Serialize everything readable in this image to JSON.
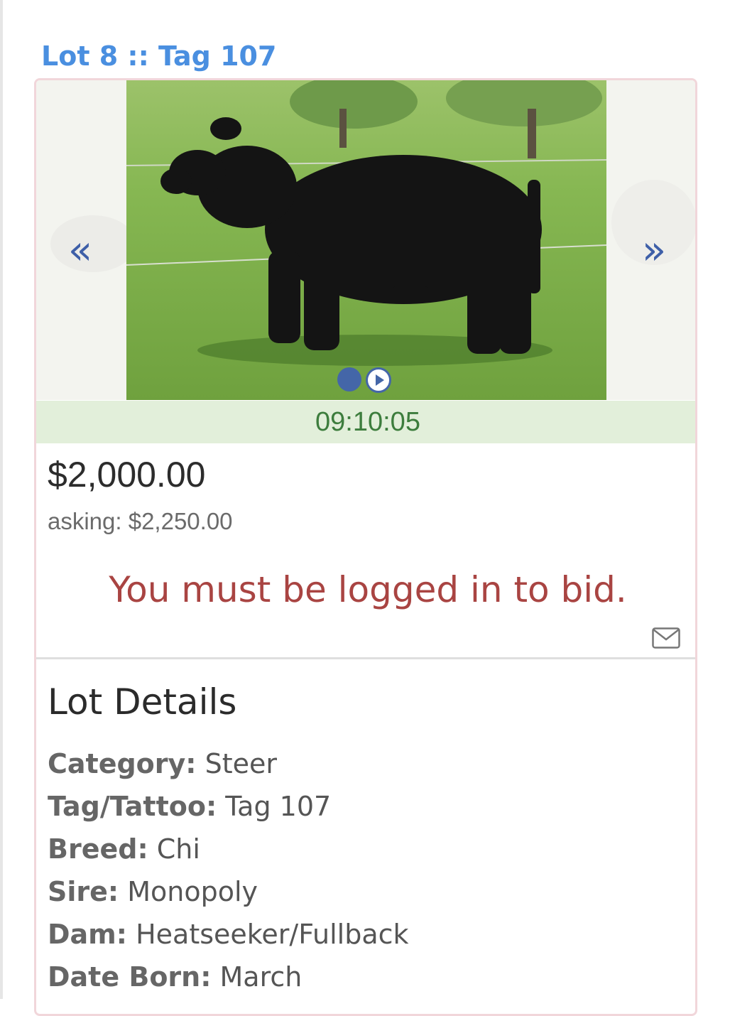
{
  "lot": {
    "heading": "Lot 8 :: Tag 107"
  },
  "gallery": {
    "prev_icon": "double-chevron-left-icon",
    "next_icon": "double-chevron-right-icon",
    "prev_glyph": "«",
    "next_glyph": "»",
    "pager": [
      "image-dot",
      "video-play-dot"
    ]
  },
  "auction": {
    "timer": "09:10:05",
    "current_bid": "$2,000.00",
    "asking": "asking: $2,250.00",
    "login_message": "You must be logged in to bid."
  },
  "details": {
    "title": "Lot Details",
    "items": [
      {
        "label": "Category:",
        "value": "Steer"
      },
      {
        "label": "Tag/Tattoo:",
        "value": "Tag 107"
      },
      {
        "label": "Breed:",
        "value": "Chi"
      },
      {
        "label": "Sire:",
        "value": "Monopoly"
      },
      {
        "label": "Dam:",
        "value": "Heatseeker/Fullback"
      },
      {
        "label": "Date Born:",
        "value": "March"
      }
    ]
  },
  "colors": {
    "heading": "#4a8fe0",
    "timer_bg": "#e2efda",
    "timer_text": "#3d7d3d",
    "login_message": "#a94442",
    "card_border": "#f1d6da",
    "nav_arrow": "#3e5fa8"
  }
}
